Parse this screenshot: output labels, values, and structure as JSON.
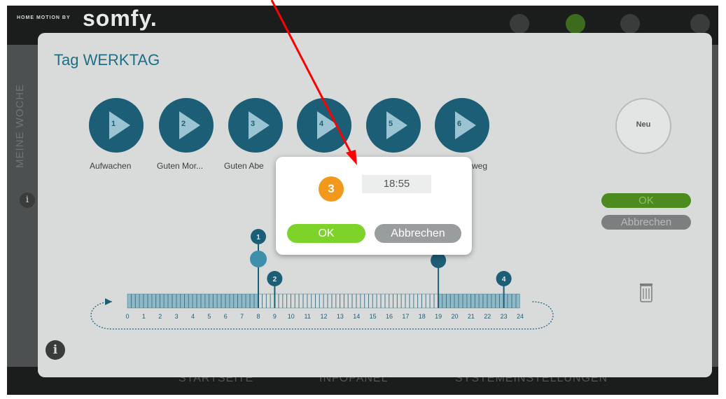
{
  "header": {
    "logo_small": "HOME MOTION BY",
    "logo_big": "somfy."
  },
  "bottom_nav": {
    "items": [
      "STARTSEITE",
      "INFOPANEL",
      "SYSTEMEINSTELLUNGEN"
    ]
  },
  "dialog": {
    "title": "Tag WERKTAG",
    "side_label": "MEINE WOCHE",
    "scenes": [
      {
        "num": "1",
        "label": "Aufwachen"
      },
      {
        "num": "2",
        "label": "Guten Mor..."
      },
      {
        "num": "3",
        "label": "Guten Abe"
      },
      {
        "num": "4",
        "label": ""
      },
      {
        "num": "5",
        "label": ""
      },
      {
        "num": "6",
        "label": "weg"
      }
    ],
    "new_button": "Neu",
    "ok_label": "OK",
    "cancel_label": "Abbrechen"
  },
  "timeline": {
    "hours": [
      "0",
      "1",
      "2",
      "3",
      "4",
      "5",
      "6",
      "7",
      "8",
      "9",
      "10",
      "11",
      "12",
      "13",
      "14",
      "15",
      "16",
      "17",
      "18",
      "19",
      "20",
      "21",
      "22",
      "23",
      "24"
    ],
    "markers": [
      {
        "num": "1",
        "hour": 8
      },
      {
        "num": "2",
        "hour": 9
      },
      {
        "num": "",
        "hour": 19,
        "icon": "moon-icon"
      },
      {
        "num": "4",
        "hour": 23
      }
    ]
  },
  "popup": {
    "badge": "3",
    "time": "18:55",
    "ok_label": "OK",
    "cancel_label": "Abbrechen"
  },
  "colors": {
    "accent": "#1c5e75",
    "ok_green": "#7dd32a",
    "badge_orange": "#f2991c",
    "annotation_red": "#ff0000"
  }
}
